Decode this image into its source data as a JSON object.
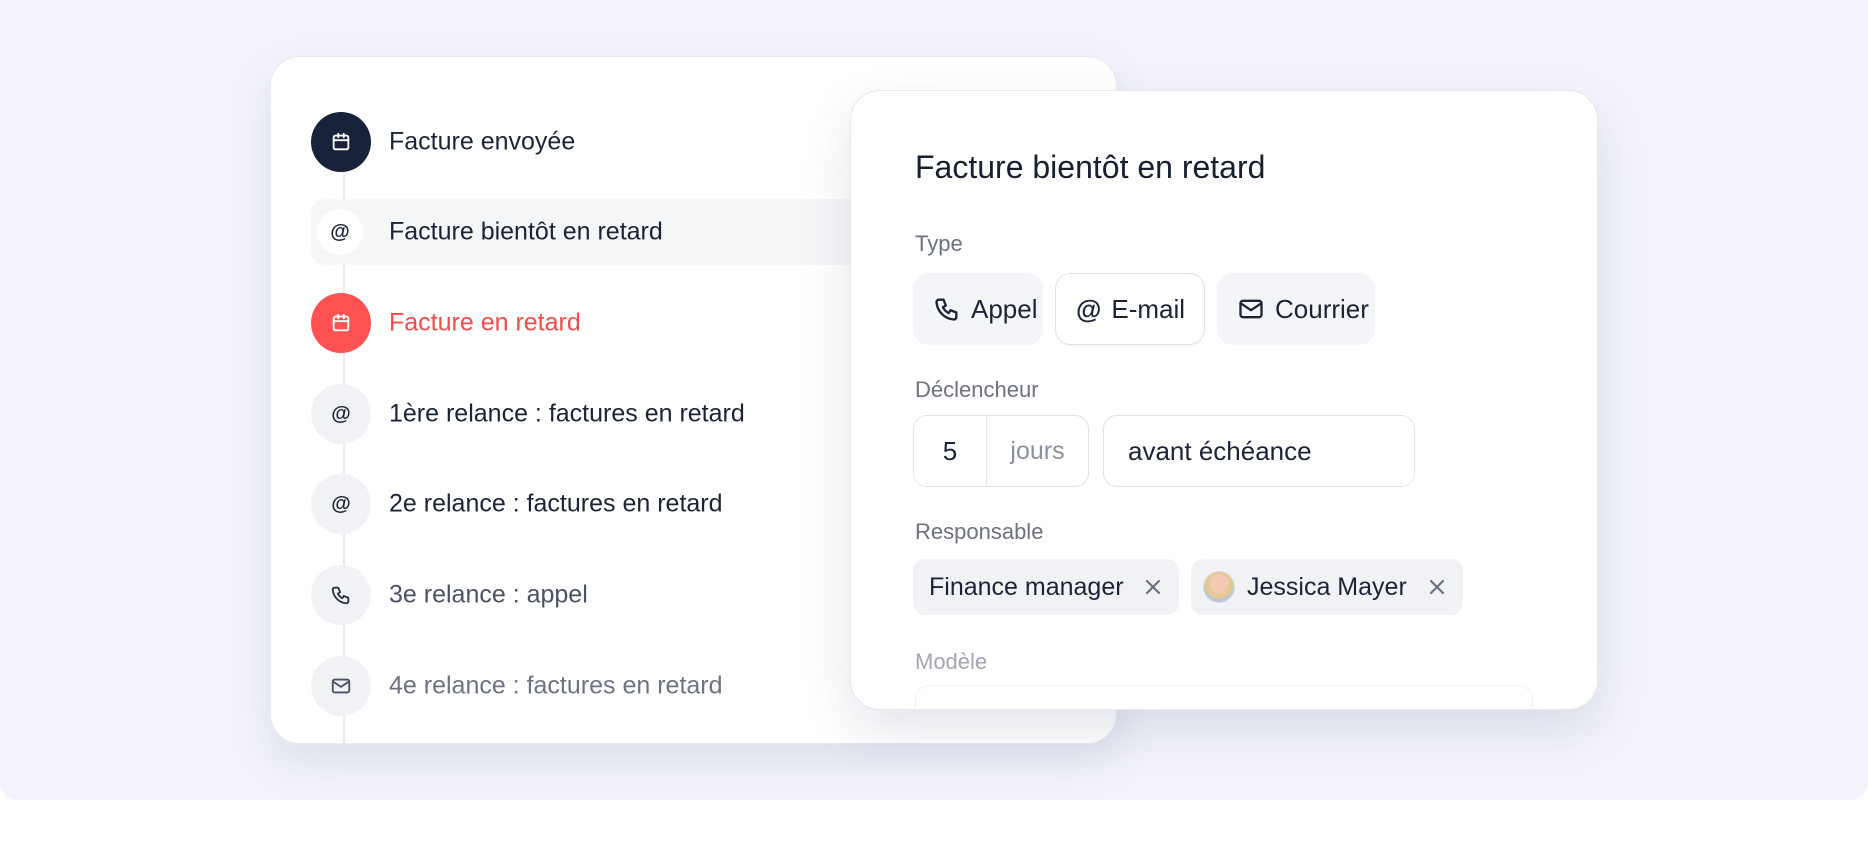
{
  "timeline": {
    "steps": [
      {
        "label": "Facture envoyée",
        "icon": "calendar-icon",
        "state": "done"
      },
      {
        "label": "Facture bientôt en retard",
        "icon": "at-icon",
        "state": "active"
      },
      {
        "label": "Facture en retard",
        "icon": "calendar-icon",
        "state": "alert"
      },
      {
        "label": "1ère relance : factures en retard",
        "icon": "at-icon",
        "state": "pending"
      },
      {
        "label": "2e relance : factures en retard",
        "icon": "at-icon",
        "state": "pending"
      },
      {
        "label": "3e relance : appel",
        "icon": "phone-icon",
        "state": "pending"
      },
      {
        "label": "4e relance : factures en retard",
        "icon": "mail-icon",
        "state": "pending"
      }
    ]
  },
  "detail": {
    "title": "Facture bientôt en retard",
    "type_label": "Type",
    "type_options": [
      {
        "label": "Appel",
        "icon": "phone-icon",
        "selected": false
      },
      {
        "label": "E-mail",
        "icon": "at-icon",
        "selected": true
      },
      {
        "label": "Courrier",
        "icon": "mail-icon",
        "selected": false
      }
    ],
    "trigger_label": "Déclencheur",
    "trigger_value": "5",
    "trigger_unit": "jours",
    "trigger_relation": "avant échéance",
    "responsible_label": "Responsable",
    "responsibles": [
      {
        "label": "Finance manager"
      },
      {
        "label": "Jessica Mayer",
        "avatar": true
      }
    ],
    "template_label": "Modèle"
  },
  "colors": {
    "dark": "#18223a",
    "alert": "#ff5252",
    "background": "#f3f4fb"
  }
}
